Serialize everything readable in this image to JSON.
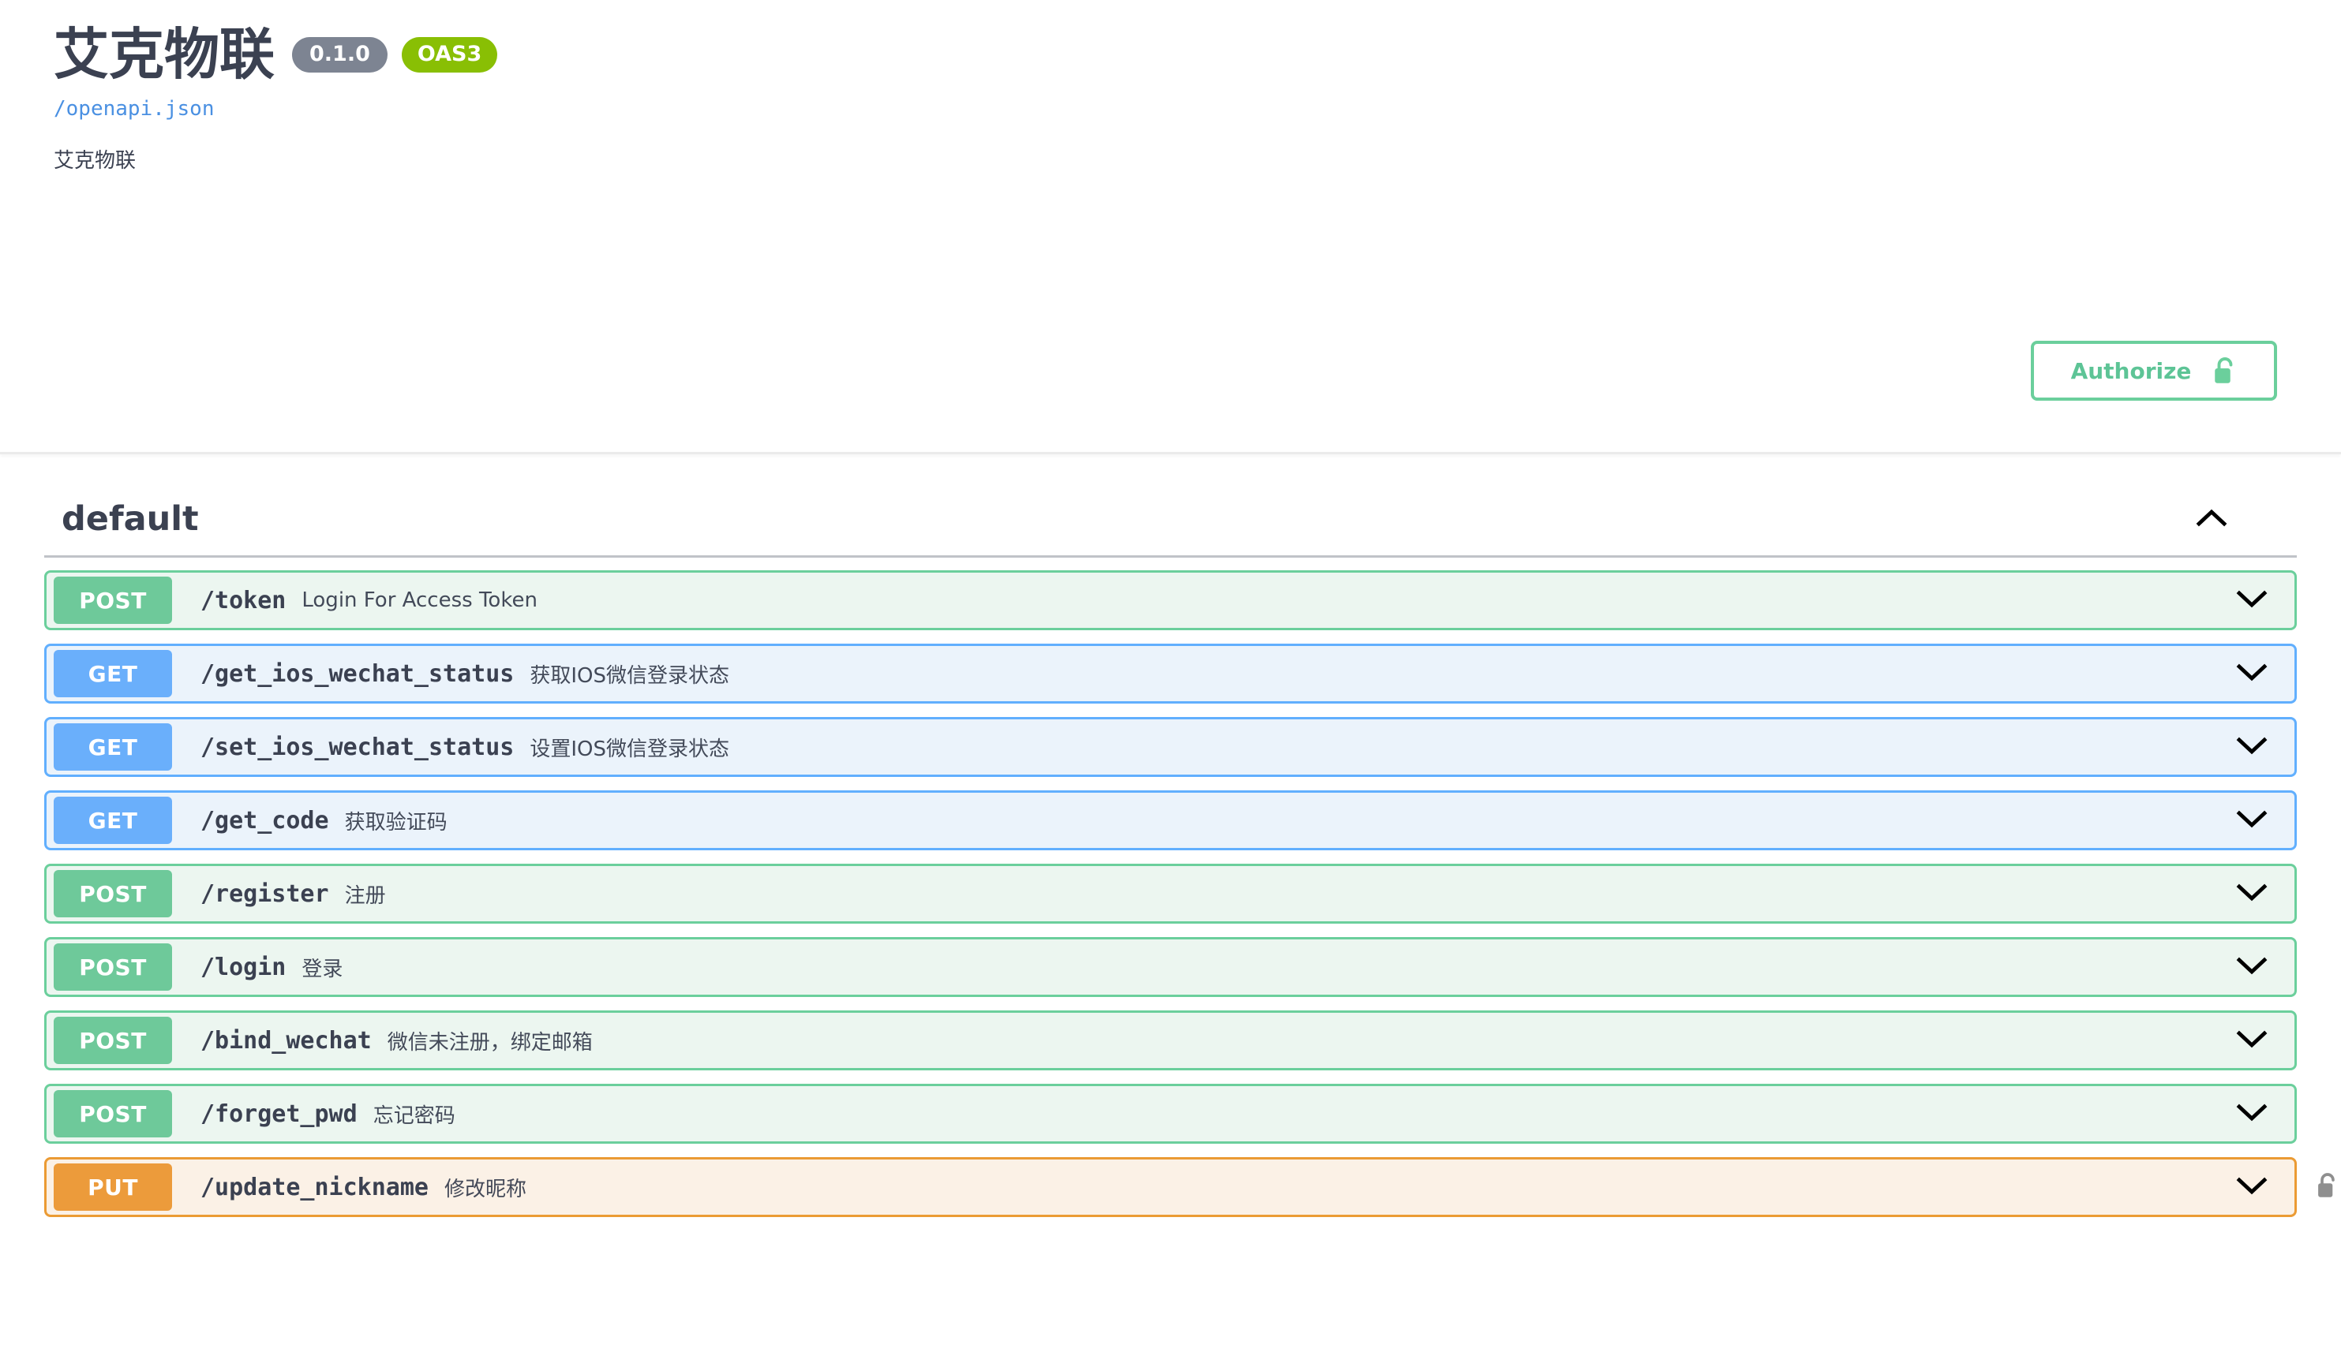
{
  "header": {
    "title": "艾克物联",
    "version_badge": "0.1.0",
    "oas_badge": "OAS3",
    "spec_url": "/openapi.json",
    "description": "艾克物联"
  },
  "authorize": {
    "label": "Authorize",
    "icon": "unlock-icon"
  },
  "tag_section": {
    "name": "default",
    "expanded": true,
    "chevron": "chevron-up-icon"
  },
  "colors": {
    "get": "#61affe",
    "get_badge": "#6aaffb",
    "get_bg": "#ebf3fb",
    "post": "#6bcf9c",
    "post_badge": "#6ec99a",
    "post_bg": "#ecf6f0",
    "put": "#eb9b34",
    "put_badge": "#ec9b3b",
    "put_bg": "#fbf1e6",
    "title": "#3b4151",
    "link": "#4a90e2",
    "version_badge": "#7d8492",
    "oas_badge": "#89bf04"
  },
  "operations": [
    {
      "method": "POST",
      "method_class": "post",
      "path": "/token",
      "summary": "Login For Access Token",
      "locked": false
    },
    {
      "method": "GET",
      "method_class": "get",
      "path": "/get_ios_wechat_status",
      "summary": "获取IOS微信登录状态",
      "locked": false
    },
    {
      "method": "GET",
      "method_class": "get",
      "path": "/set_ios_wechat_status",
      "summary": "设置IOS微信登录状态",
      "locked": false
    },
    {
      "method": "GET",
      "method_class": "get",
      "path": "/get_code",
      "summary": "获取验证码",
      "locked": false
    },
    {
      "method": "POST",
      "method_class": "post",
      "path": "/register",
      "summary": "注册",
      "locked": false
    },
    {
      "method": "POST",
      "method_class": "post",
      "path": "/login",
      "summary": "登录",
      "locked": false
    },
    {
      "method": "POST",
      "method_class": "post",
      "path": "/bind_wechat",
      "summary": "微信未注册，绑定邮箱",
      "locked": false
    },
    {
      "method": "POST",
      "method_class": "post",
      "path": "/forget_pwd",
      "summary": "忘记密码",
      "locked": false
    },
    {
      "method": "PUT",
      "method_class": "put",
      "path": "/update_nickname",
      "summary": "修改昵称",
      "locked": true
    }
  ]
}
